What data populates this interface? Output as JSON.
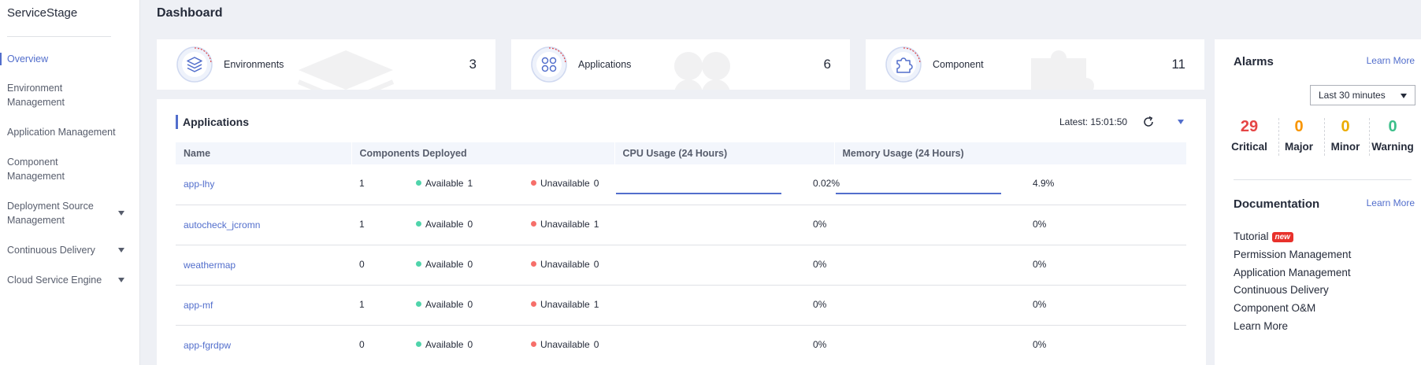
{
  "sidebar": {
    "brand": "ServiceStage",
    "items": [
      {
        "label": "Overview",
        "active": true,
        "expandable": false
      },
      {
        "label": "Environment Management",
        "active": false,
        "expandable": false
      },
      {
        "label": "Application Management",
        "active": false,
        "expandable": false
      },
      {
        "label": "Component Management",
        "active": false,
        "expandable": false
      },
      {
        "label": "Deployment Source Management",
        "active": false,
        "expandable": true
      },
      {
        "label": "Continuous Delivery",
        "active": false,
        "expandable": true
      },
      {
        "label": "Cloud Service Engine",
        "active": false,
        "expandable": true
      }
    ]
  },
  "header": {
    "title": "Dashboard"
  },
  "stats": [
    {
      "label": "Environments",
      "value": "3",
      "icon": "layers-icon"
    },
    {
      "label": "Applications",
      "value": "6",
      "icon": "apps-grid-icon"
    },
    {
      "label": "Component",
      "value": "11",
      "icon": "puzzle-icon"
    }
  ],
  "applications": {
    "title": "Applications",
    "latest_label": "Latest:",
    "latest_time": "15:01:50",
    "columns": [
      "Name",
      "Components Deployed",
      "CPU Usage (24 Hours)",
      "Memory Usage (24 Hours)"
    ],
    "available_label": "Available",
    "unavailable_label": "Unavailable",
    "rows": [
      {
        "name": "app-lhy",
        "components": "1",
        "available": "1",
        "unavailable": "0",
        "cpu": "0.02%",
        "memory": "4.9%",
        "has_usage_line": true
      },
      {
        "name": "autocheck_jcromn",
        "components": "1",
        "available": "0",
        "unavailable": "1",
        "cpu": "0%",
        "memory": "0%",
        "has_usage_line": false
      },
      {
        "name": "weathermap",
        "components": "0",
        "available": "0",
        "unavailable": "0",
        "cpu": "0%",
        "memory": "0%",
        "has_usage_line": false
      },
      {
        "name": "app-mf",
        "components": "1",
        "available": "0",
        "unavailable": "1",
        "cpu": "0%",
        "memory": "0%",
        "has_usage_line": false
      },
      {
        "name": "app-fgrdpw",
        "components": "0",
        "available": "0",
        "unavailable": "0",
        "cpu": "0%",
        "memory": "0%",
        "has_usage_line": false
      }
    ]
  },
  "alarms": {
    "title": "Alarms",
    "learn_more": "Learn More",
    "time_range": "Last 30 minutes",
    "levels": [
      {
        "label": "Critical",
        "count": "29",
        "color": "#e54545"
      },
      {
        "label": "Major",
        "count": "0",
        "color": "#f89500"
      },
      {
        "label": "Minor",
        "count": "0",
        "color": "#ebac00"
      },
      {
        "label": "Warning",
        "count": "0",
        "color": "#3cbf8a"
      }
    ]
  },
  "documentation": {
    "title": "Documentation",
    "learn_more": "Learn More",
    "new_badge": "new",
    "items": [
      "Tutorial",
      "Permission Management",
      "Application Management",
      "Continuous Delivery",
      "Component O&M",
      "Learn More"
    ]
  },
  "colors": {
    "accent": "#526ecc",
    "available": "#50d4ab",
    "unavailable": "#f66f6a"
  }
}
